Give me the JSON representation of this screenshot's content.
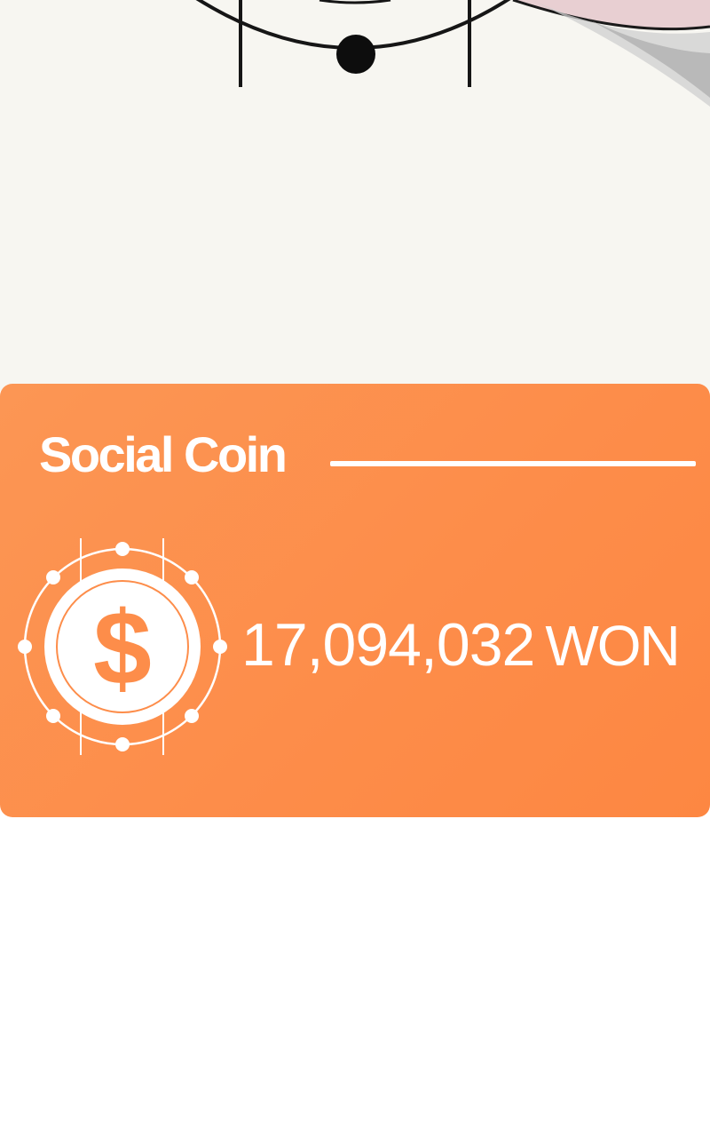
{
  "card": {
    "title": "Social Coin",
    "amount": "17,094,032",
    "currency": "WON",
    "accent_color": "#fd8d4a",
    "icon": "dollar-coin-icon"
  },
  "illustration": {
    "icon": "circuit-circle-illustration"
  }
}
